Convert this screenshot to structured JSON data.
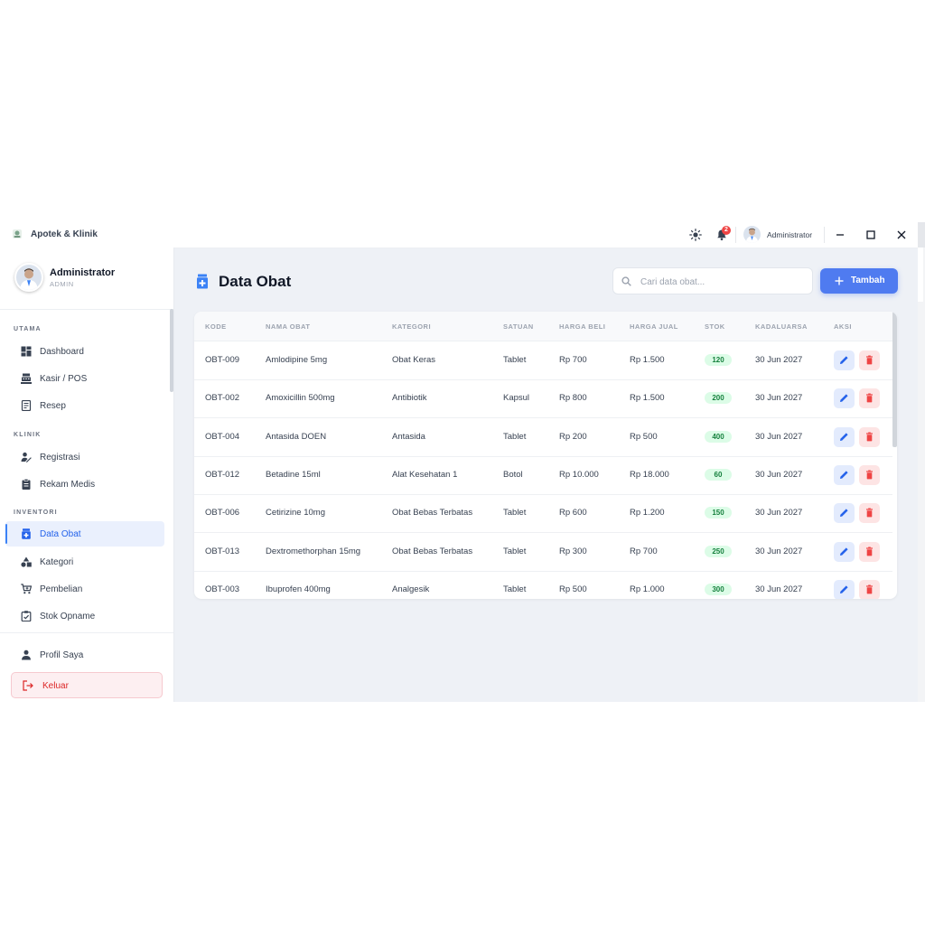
{
  "app": {
    "title": "Apotek & Klinik",
    "notification_count": "2",
    "user_name": "Administrator"
  },
  "sidebar": {
    "profile": {
      "name": "Administrator",
      "role": "ADMIN"
    },
    "sections": [
      {
        "label": "UTAMA",
        "items": [
          {
            "label": "Dashboard",
            "icon": "dashboard-icon"
          },
          {
            "label": "Kasir / POS",
            "icon": "cash-register-icon"
          },
          {
            "label": "Resep",
            "icon": "prescription-icon"
          }
        ]
      },
      {
        "label": "KLINIK",
        "items": [
          {
            "label": "Registrasi",
            "icon": "person-add-icon"
          },
          {
            "label": "Rekam Medis",
            "icon": "clipboard-icon"
          }
        ]
      },
      {
        "label": "INVENTORI",
        "items": [
          {
            "label": "Data Obat",
            "icon": "medicine-icon",
            "active": true
          },
          {
            "label": "Kategori",
            "icon": "category-icon"
          },
          {
            "label": "Pembelian",
            "icon": "cart-icon"
          },
          {
            "label": "Stok Opname",
            "icon": "clipboard-check-icon"
          }
        ]
      }
    ],
    "profile_link": "Profil Saya",
    "logout": "Keluar"
  },
  "main": {
    "title": "Data Obat",
    "search_placeholder": "Cari data obat...",
    "add_button": "Tambah",
    "table": {
      "columns": [
        "KODE",
        "NAMA OBAT",
        "KATEGORI",
        "SATUAN",
        "HARGA BELI",
        "HARGA JUAL",
        "STOK",
        "KADALUARSA",
        "AKSI"
      ],
      "rows": [
        [
          "OBT-009",
          "Amlodipine 5mg",
          "Obat Keras",
          "Tablet",
          "Rp 700",
          "Rp 1.500",
          "120",
          "30 Jun 2027"
        ],
        [
          "OBT-002",
          "Amoxicillin 500mg",
          "Antibiotik",
          "Kapsul",
          "Rp 800",
          "Rp 1.500",
          "200",
          "30 Jun 2027"
        ],
        [
          "OBT-004",
          "Antasida DOEN",
          "Antasida",
          "Tablet",
          "Rp 200",
          "Rp 500",
          "400",
          "30 Jun 2027"
        ],
        [
          "OBT-012",
          "Betadine 15ml",
          "Alat Kesehatan 1",
          "Botol",
          "Rp 10.000",
          "Rp 18.000",
          "60",
          "30 Jun 2027"
        ],
        [
          "OBT-006",
          "Cetirizine 10mg",
          "Obat Bebas Terbatas",
          "Tablet",
          "Rp 600",
          "Rp 1.200",
          "150",
          "30 Jun 2027"
        ],
        [
          "OBT-013",
          "Dextromethorphan 15mg",
          "Obat Bebas Terbatas",
          "Tablet",
          "Rp 300",
          "Rp 700",
          "250",
          "30 Jun 2027"
        ],
        [
          "OBT-003",
          "Ibuprofen 400mg",
          "Analgesik",
          "Tablet",
          "Rp 500",
          "Rp 1.000",
          "300",
          "30 Jun 2027"
        ]
      ]
    }
  },
  "colors": {
    "accent": "#4f7bf0",
    "danger": "#ef4444",
    "stock_badge_bg": "#dcfce7",
    "stock_badge_text": "#15803d"
  }
}
